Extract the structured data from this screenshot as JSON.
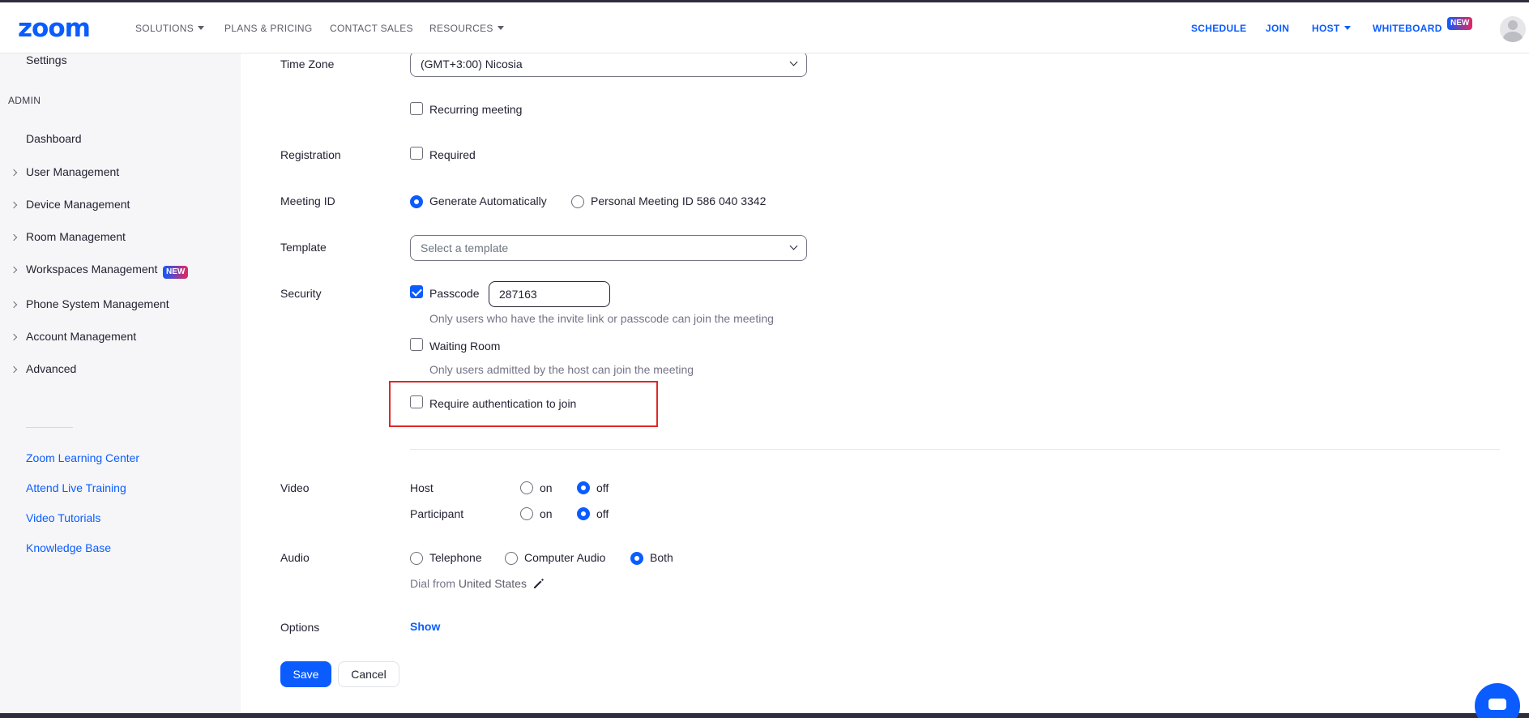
{
  "header": {
    "logo": "zoom",
    "nav": [
      {
        "label": "SOLUTIONS",
        "has_caret": true
      },
      {
        "label": "PLANS & PRICING",
        "has_caret": false
      },
      {
        "label": "CONTACT SALES",
        "has_caret": false
      },
      {
        "label": "RESOURCES",
        "has_caret": true
      }
    ],
    "nav_right": {
      "schedule": "SCHEDULE",
      "join": "JOIN",
      "host": "HOST",
      "whiteboard": "WHITEBOARD",
      "whiteboard_badge": "NEW"
    }
  },
  "sidebar": {
    "settings": "Settings",
    "admin_section": "ADMIN",
    "dashboard": "Dashboard",
    "items": [
      "User Management",
      "Device Management",
      "Room Management",
      "Workspaces Management",
      "Phone System Management",
      "Account Management",
      "Advanced"
    ],
    "workspaces_badge": "NEW",
    "links": [
      "Zoom Learning Center",
      "Attend Live Training",
      "Video Tutorials",
      "Knowledge Base"
    ]
  },
  "form": {
    "time_zone": {
      "label": "Time Zone",
      "value": "(GMT+3:00) Nicosia"
    },
    "recurring": {
      "label": "Recurring meeting",
      "checked": false
    },
    "registration": {
      "label": "Registration",
      "option": "Required",
      "checked": false
    },
    "meeting_id": {
      "label": "Meeting ID",
      "generate": "Generate Automatically",
      "personal": "Personal Meeting ID 586 040 3342",
      "selected": "generate"
    },
    "template": {
      "label": "Template",
      "placeholder": "Select a template"
    },
    "security": {
      "label": "Security",
      "passcode_label": "Passcode",
      "passcode_checked": true,
      "passcode_value": "287163",
      "passcode_hint": "Only users who have the invite link or passcode can join the meeting",
      "waiting_room_label": "Waiting Room",
      "waiting_room_checked": false,
      "waiting_room_hint": "Only users admitted by the host can join the meeting",
      "auth_label": "Require authentication to join",
      "auth_checked": false
    },
    "video": {
      "label": "Video",
      "host": "Host",
      "participant": "Participant",
      "on": "on",
      "off": "off",
      "host_selected": "off",
      "participant_selected": "off"
    },
    "audio": {
      "label": "Audio",
      "telephone": "Telephone",
      "computer": "Computer Audio",
      "both": "Both",
      "selected": "both",
      "dial_from": "Dial from",
      "dial_country": "United States"
    },
    "options": {
      "label": "Options",
      "show": "Show"
    },
    "save": "Save",
    "cancel": "Cancel"
  },
  "colors": {
    "accent": "#0b5cff",
    "highlight": "#e02828",
    "badge_gradient_end": "#e8265e"
  }
}
